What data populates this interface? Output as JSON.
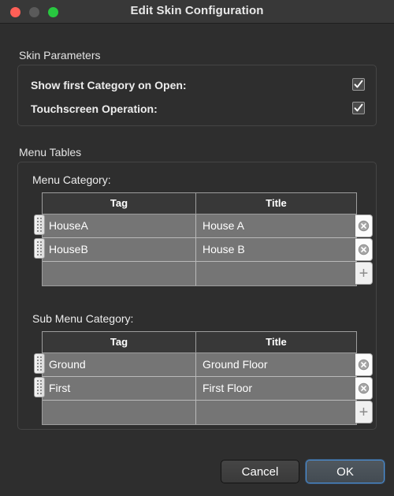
{
  "window": {
    "title": "Edit Skin Configuration",
    "traffic_lights": [
      {
        "name": "close",
        "color": "#ff5f57"
      },
      {
        "name": "minimize",
        "color": "#5a5a5a"
      },
      {
        "name": "maximize",
        "color": "#28c840"
      }
    ]
  },
  "skin_parameters": {
    "label": "Skin Parameters",
    "rows": [
      {
        "label": "Show first Category on Open:",
        "checked": true
      },
      {
        "label": "Touchscreen Operation:",
        "checked": true
      }
    ]
  },
  "menu_tables": {
    "label": "Menu Tables",
    "tables": [
      {
        "title": "Menu Category:",
        "columns": [
          "Tag",
          "Title"
        ],
        "rows": [
          {
            "tag": "HouseA",
            "title": "House A"
          },
          {
            "tag": "HouseB",
            "title": "House B"
          }
        ],
        "empty_row": {
          "tag": "",
          "title": ""
        },
        "add_label": "+"
      },
      {
        "title": "Sub Menu Category:",
        "columns": [
          "Tag",
          "Title"
        ],
        "rows": [
          {
            "tag": "Ground",
            "title": "Ground Floor"
          },
          {
            "tag": "First",
            "title": "First Floor"
          }
        ],
        "empty_row": {
          "tag": "",
          "title": ""
        },
        "add_label": "+"
      }
    ]
  },
  "footer": {
    "cancel_label": "Cancel",
    "ok_label": "OK",
    "default_button": "OK",
    "accent_color": "#4a90d9"
  }
}
